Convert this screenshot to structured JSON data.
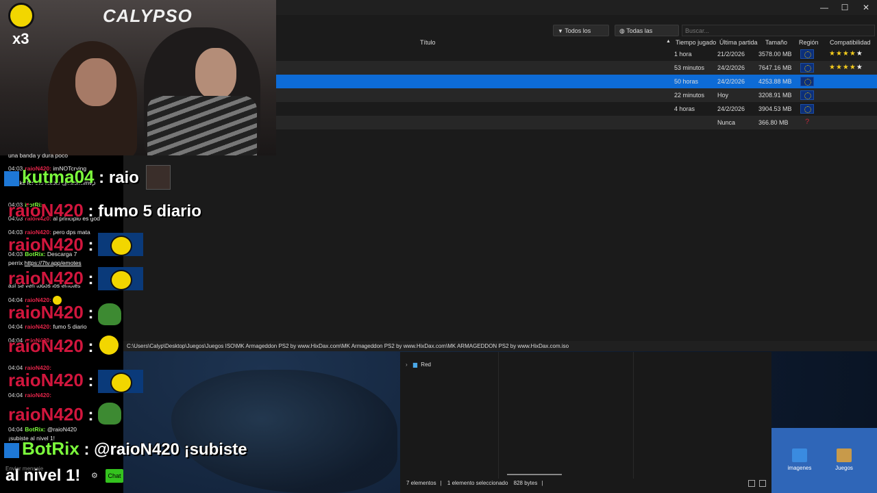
{
  "window": {
    "minimize": "—",
    "maximize": "☐",
    "close": "✕"
  },
  "toolbar": {
    "type_filter": "Todos los tipos",
    "region_filter": "Todas las regiones",
    "search_placeholder": "Buscar..."
  },
  "table": {
    "headers": {
      "title": "Título",
      "playtime": "Tiempo jugado",
      "last_played": "Última partida",
      "size": "Tamaño",
      "region": "Región",
      "compat": "Compatibilidad"
    },
    "rows": [
      {
        "playtime": "1 hora",
        "last_played": "21/2/2026",
        "size": "3578.00 MB",
        "region": "eu-flag",
        "stars": 5,
        "stars_str": "★★★★",
        "star_last": "★"
      },
      {
        "playtime": "53 minutos",
        "last_played": "24/2/2026",
        "size": "7647.16 MB",
        "region": "eu-flag",
        "stars": 5,
        "stars_str": "★★★★",
        "star_last": "★"
      },
      {
        "playtime": "50 horas",
        "last_played": "24/2/2026",
        "size": "4253.88 MB",
        "region": "eu-flag",
        "selected": true
      },
      {
        "playtime": "22 minutos",
        "last_played": "Hoy",
        "size": "3208.91 MB",
        "region": "eu-flag"
      },
      {
        "playtime": "4 horas",
        "last_played": "24/2/2026",
        "size": "3904.53 MB",
        "region": "eu-flag"
      },
      {
        "playtime": "",
        "last_played": "Nunca",
        "size": "366.80 MB",
        "region": "unknown-pin"
      }
    ]
  },
  "statusbar": {
    "path": "C:\\Users\\Calyp\\Desktop\\Juegos\\Juegos ISO\\MK Armageddon PS2 by www.HixDax.com\\MK Armageddon PS2 by www.HixDax.com\\MK ARMAGEDDON PS2 by www.HixDax.com.iso"
  },
  "explorer": {
    "nav_item": "Red",
    "items_count": "7 elementos",
    "selected_count": "1 elemento seleccionado",
    "selected_size": "828 bytes"
  },
  "desktop": {
    "icon1": "imagenes",
    "icon2": "Juegos"
  },
  "overlay": {
    "logo": "CALYPSO",
    "multiplier": "x3"
  },
  "chat": {
    "lines": {
      "l1": "una banda y dura poco",
      "l2_ts": "04:03",
      "l2_user": "raioN420:",
      "l2_text": "imNOTcrying",
      "l3_text": "thanks for the follow @michelmvp",
      "l4_ts": "04:03",
      "l4_user": "BotRix:",
      "l5_ts": "04:03",
      "l5_user": "raioN420:",
      "l5_text": "al principio es god",
      "l6_ts": "04:03",
      "l6_user": "raioN420:",
      "l6_text": "pero dps mata",
      "l7_ts": "04:03",
      "l7_user": "BotRix:",
      "l7_text": "Descarga 7",
      "l8_text": "perrix",
      "l8_link": "https://7tv.app/emotes",
      "l9_text": "así se ven todos los emotes",
      "l10_ts": "04:04",
      "l10_user": "raioN420:",
      "l11_ts": "04:04",
      "l11_user": "raioN420:",
      "l11_text": "fumo 5 diario",
      "l12_ts": "04:04",
      "l12_user": "raioN420:",
      "l13_ts": "04:04",
      "l13_user": "raioN420:",
      "l14_ts": "04:04",
      "l14_user": "raioN420:",
      "l15_ts": "04:04",
      "l15_user": "BotRix:",
      "l15_text": "@raioN420",
      "l16_text": "¡subiste al nivel 1!"
    },
    "input_placeholder": "Enviar mensaje",
    "chat_button": "Chat"
  },
  "big_messages": {
    "m1_user": "kutma04",
    "m1_text": " : raio",
    "m2_user": "raioN420",
    "m2_text": " : fumo 5 diario",
    "m3_user": "raioN420",
    "m3_text": " :",
    "m4_user": "raioN420",
    "m4_text": " :",
    "m5_user": "raioN420",
    "m5_text": " :",
    "m6_user": "raioN420",
    "m6_text": " :",
    "m7_user": "raioN420",
    "m7_text": " :",
    "m8_user": "raioN420",
    "m8_text": " :",
    "m9_user": "BotRix",
    "m9_text": " : @raioN420 ¡subiste",
    "m9_line2": "al nivel 1!"
  }
}
